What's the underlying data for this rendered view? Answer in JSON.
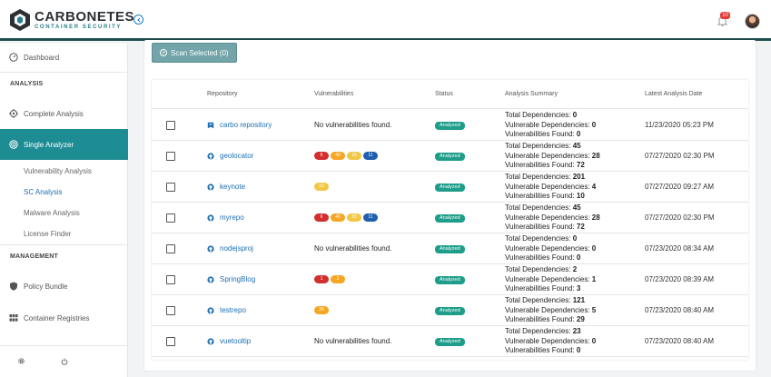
{
  "app": {
    "brand_title": "CARBONETES",
    "brand_subtitle": "CONTAINER SECURITY",
    "notification_count": "10"
  },
  "sidebar": {
    "dashboard": "Dashboard",
    "section_analysis": "ANALYSIS",
    "complete_analysis": "Complete Analysis",
    "single_analyzer": "Single Analyzer",
    "sub_items": [
      "Vulnerability Analysis",
      "SC Analysis",
      "Malware Analysis",
      "License Finder"
    ],
    "section_management": "MANAGEMENT",
    "policy_bundle": "Policy Bundle",
    "container_registries": "Container Registries"
  },
  "toolbar": {
    "scan_selected_label": "Scan Selected (0)"
  },
  "table": {
    "headers": {
      "repository": "Repository",
      "vulnerabilities": "Vulnerabilities",
      "status": "Status",
      "analysis_summary": "Analysis Summary",
      "latest_date": "Latest Analysis Date"
    },
    "summary_labels": {
      "total": "Total Dependencies:",
      "vulnerable": "Vulnerable Dependencies:",
      "found": "Vulnerabilities Found:"
    },
    "no_vuln_text": "No vulnerabilities found.",
    "rows": [
      {
        "repo": "carbo repository",
        "icon": "registry-icon",
        "vulns": [],
        "status": "Analyzed",
        "total": "0",
        "vulnerable": "0",
        "found": "0",
        "date": "11/23/2020 05:23 PM"
      },
      {
        "repo": "geolocator",
        "icon": "github-icon",
        "vulns": [
          {
            "v": "6",
            "c": "#d32f2f"
          },
          {
            "v": "40",
            "c": "#f5a623"
          },
          {
            "v": "15",
            "c": "#f2c744"
          },
          {
            "v": "11",
            "c": "#1f5fae"
          }
        ],
        "status": "Analyzed",
        "total": "45",
        "vulnerable": "28",
        "found": "72",
        "date": "07/27/2020 02:30 PM"
      },
      {
        "repo": "keynote",
        "icon": "github-icon",
        "vulns": [
          {
            "v": "10",
            "c": "#f2c744"
          }
        ],
        "status": "Analyzed",
        "total": "201",
        "vulnerable": "4",
        "found": "10",
        "date": "07/27/2020 09:27 AM"
      },
      {
        "repo": "myrepo",
        "icon": "github-icon",
        "vulns": [
          {
            "v": "6",
            "c": "#d32f2f"
          },
          {
            "v": "40",
            "c": "#f5a623"
          },
          {
            "v": "15",
            "c": "#f2c744"
          },
          {
            "v": "11",
            "c": "#1f5fae"
          }
        ],
        "status": "Analyzed",
        "total": "45",
        "vulnerable": "28",
        "found": "72",
        "date": "07/27/2020 02:30 PM"
      },
      {
        "repo": "nodejsproj",
        "icon": "github-icon",
        "vulns": [],
        "status": "Analyzed",
        "total": "0",
        "vulnerable": "0",
        "found": "0",
        "date": "07/23/2020 08:34 AM"
      },
      {
        "repo": "SpringBlog",
        "icon": "github-icon",
        "vulns": [
          {
            "v": "1",
            "c": "#d32f2f"
          },
          {
            "v": "2",
            "c": "#f5a623"
          }
        ],
        "status": "Analyzed",
        "total": "2",
        "vulnerable": "1",
        "found": "3",
        "date": "07/23/2020 08:39 AM"
      },
      {
        "repo": "testrepo",
        "icon": "github-icon",
        "vulns": [
          {
            "v": "29",
            "c": "#f5a623"
          }
        ],
        "status": "Analyzed",
        "total": "121",
        "vulnerable": "5",
        "found": "29",
        "date": "07/23/2020 08:40 AM"
      },
      {
        "repo": "vuetooltip",
        "icon": "github-icon",
        "vulns": [],
        "status": "Analyzed",
        "total": "23",
        "vulnerable": "0",
        "found": "0",
        "date": "07/23/2020 08:40 AM"
      }
    ]
  },
  "colors": {
    "accent": "#1e8c93",
    "status_green": "#1e9e8a",
    "link_blue": "#1f6fb2"
  }
}
